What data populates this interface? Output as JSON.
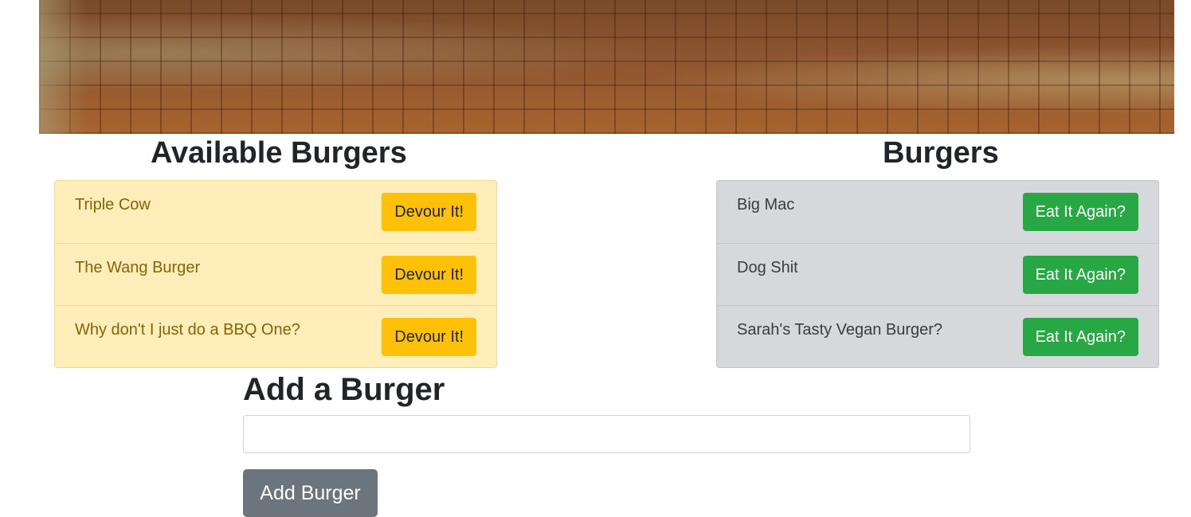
{
  "hero": {
    "image_name": "wooden-cutting-board-image"
  },
  "available": {
    "title": "Available Burgers",
    "items": [
      {
        "name": "Triple Cow",
        "button": "Devour It!"
      },
      {
        "name": "The Wang Burger",
        "button": "Devour It!"
      },
      {
        "name": "Why don't I just do a BBQ One?",
        "button": "Devour It!"
      }
    ]
  },
  "eaten": {
    "title": "Burgers",
    "items": [
      {
        "name": "Big Mac",
        "button": "Eat It Again?"
      },
      {
        "name": "Dog Shit",
        "button": "Eat It Again?"
      },
      {
        "name": "Sarah's Tasty Vegan Burger?",
        "button": "Eat It Again?"
      }
    ]
  },
  "add_form": {
    "title": "Add a Burger",
    "input_value": "",
    "input_placeholder": "",
    "submit_label": "Add Burger"
  },
  "colors": {
    "devour_button": "#ffc107",
    "eat_again_button": "#28a745",
    "available_list_bg": "#ffeeba",
    "eaten_list_bg": "#d6d8db",
    "add_button": "#6c757d"
  }
}
